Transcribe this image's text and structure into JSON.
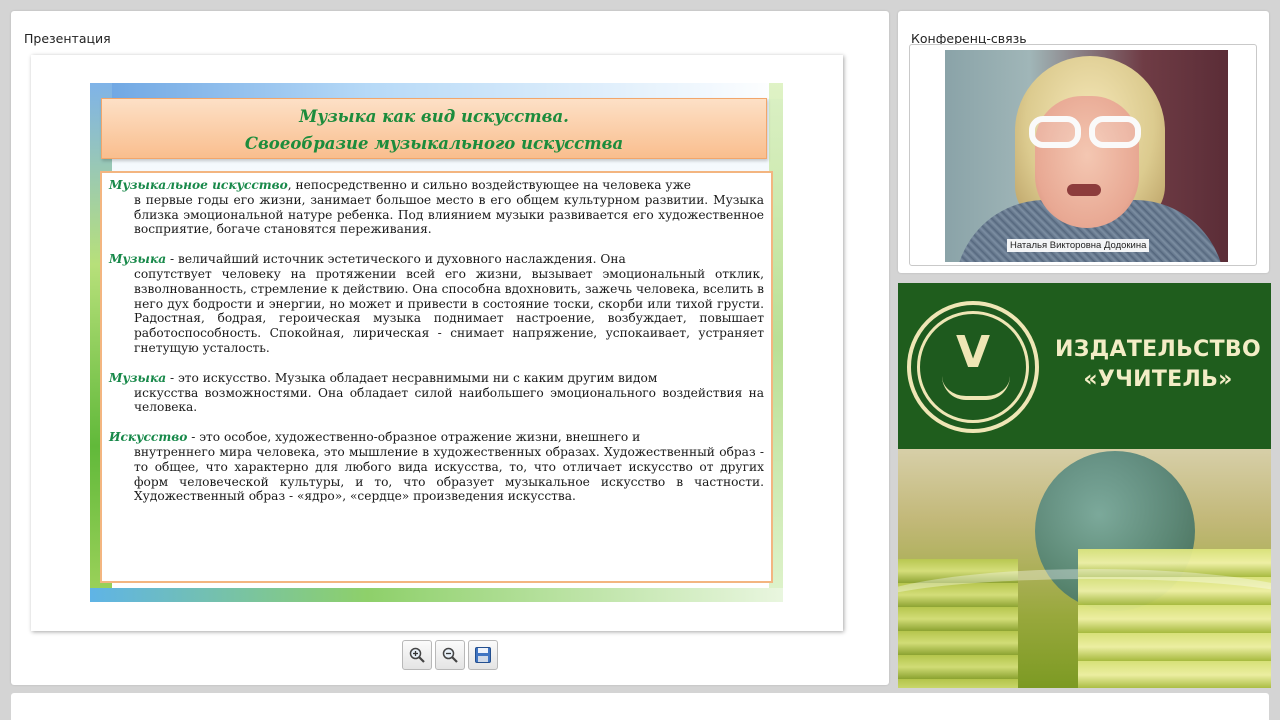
{
  "presentation": {
    "panel_title": "Презентация",
    "slide": {
      "title_line1": "Музыка как вид искусства.",
      "title_line2": "Своеобразие музыкального искусства",
      "paragraphs": [
        {
          "term": "Музыкальное искусство",
          "first": ", непосредственно и сильно воздействующее на человека уже",
          "rest": "в первые годы его жизни, занимает большое место в его общем культурном развитии. Музыка близка эмоциональной натуре ребенка. Под влиянием музыки развивается его художественное восприятие, богаче становятся переживания."
        },
        {
          "term": "Музыка",
          "first": " - величайший источник эстетического и духовного наслаждения. Она",
          "rest": "сопутствует человеку на протяжении всей его жизни, вызывает эмоциональный отклик, взволнованность, стремление к действию. Она способна вдохновить, зажечь человека, вселить в него дух бодрости и энергии, но может и привести в состояние тоски, скорби или тихой грусти. Радостная, бодрая, героическая музыка поднимает настроение, возбуждает, повышает работоспособность. Спокойная, лирическая - снимает напряжение, успокаивает, устраняет гнетущую усталость."
        },
        {
          "term": "Музыка",
          "first": " - это искусство. Музыка обладает несравнимыми ни с каким другим видом",
          "rest": "искусства возможностями. Она обладает силой наибольшего эмоционального воздействия на человека."
        },
        {
          "term": "Искусство",
          "first": " - это особое, художественно-образное отражение жизни, внешнего и",
          "rest": "внутреннего мира человека, это мышление в художественных образах. Художественный образ - то общее, что характерно для любого вида искусства, то, что отличает искусство от других форм человеческой культуры, и то, что образует музыкальное искусство в частности. Художественный образ - «ядро», «сердце» произведения искусства."
        }
      ]
    },
    "toolbar": [
      {
        "icon": "zoom-in-icon"
      },
      {
        "icon": "zoom-out-icon"
      },
      {
        "icon": "save-icon"
      }
    ]
  },
  "conference": {
    "panel_title": "Конференц-связь",
    "participant_name": "Наталья Викторовна Додокина"
  },
  "banner": {
    "brand_line1": "ИЗДАТЕЛЬСТВО",
    "brand_line2": "«УЧИТЕЛЬ»",
    "colors": {
      "green": "#1f5d1d",
      "cream": "#f3edc6"
    }
  }
}
